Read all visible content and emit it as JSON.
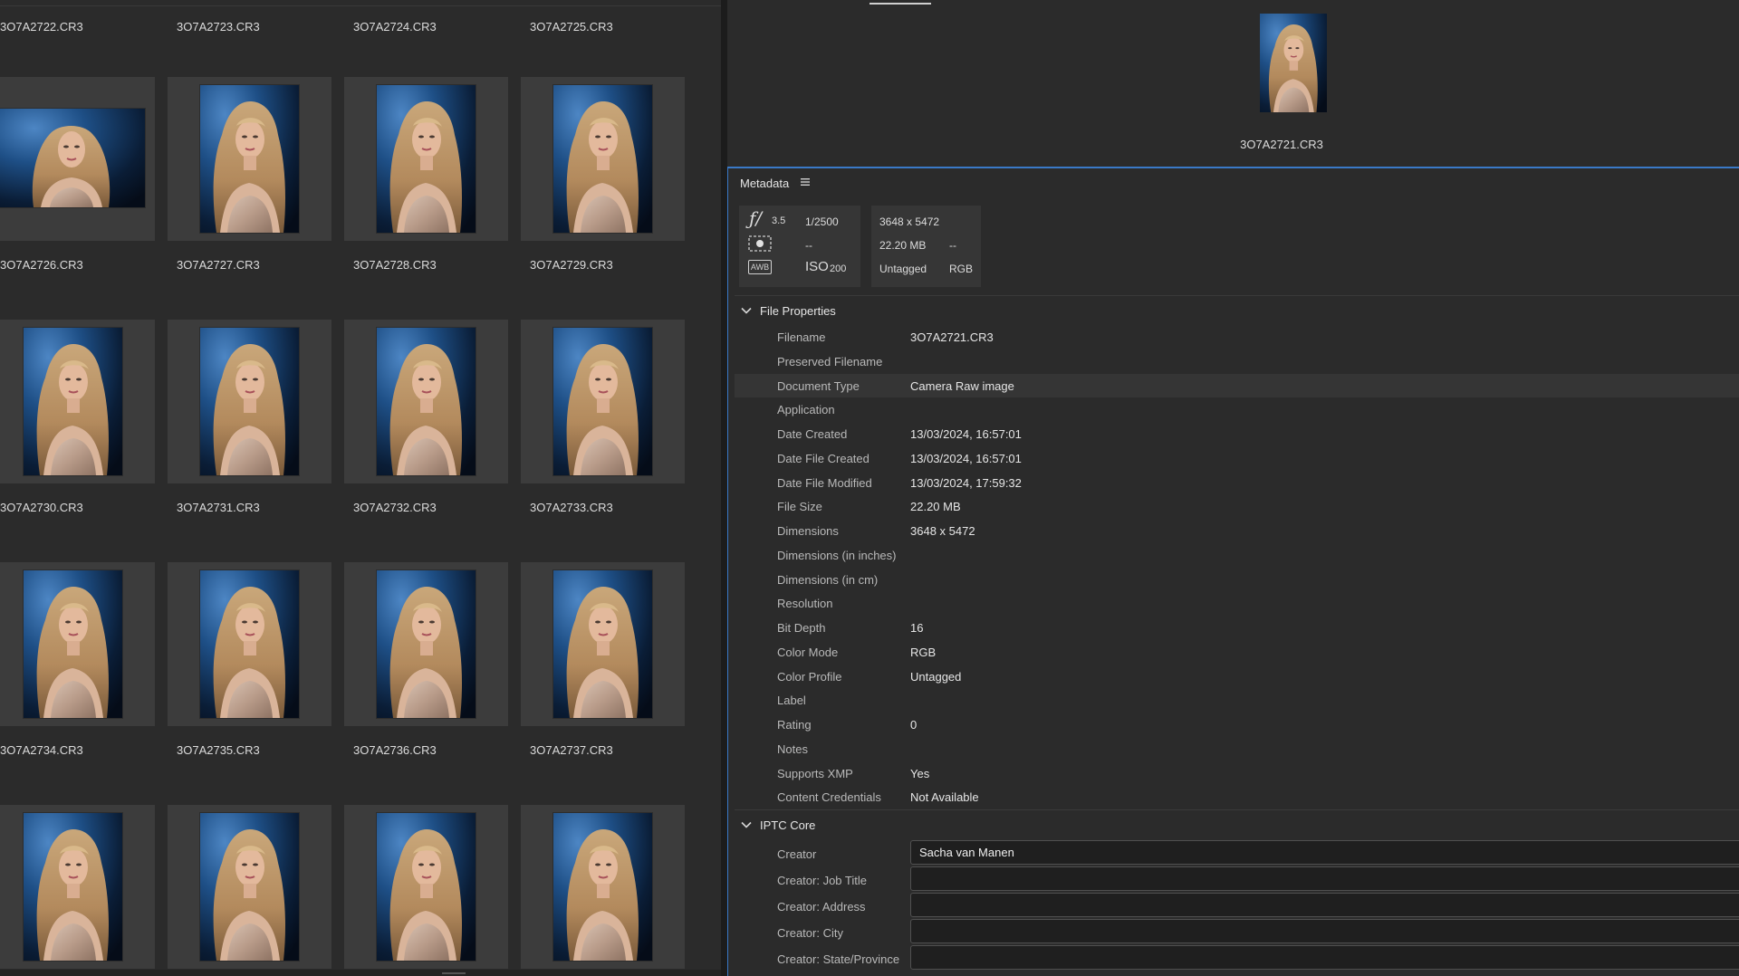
{
  "content": {
    "top_row_labels": [
      "3O7A2722.CR3",
      "3O7A2723.CR3",
      "3O7A2724.CR3",
      "3O7A2725.CR3"
    ],
    "rows": [
      [
        "3O7A2726.CR3",
        "3O7A2727.CR3",
        "3O7A2728.CR3",
        "3O7A2729.CR3"
      ],
      [
        "3O7A2730.CR3",
        "3O7A2731.CR3",
        "3O7A2732.CR3",
        "3O7A2733.CR3"
      ],
      [
        "3O7A2734.CR3",
        "3O7A2735.CR3",
        "3O7A2736.CR3",
        "3O7A2737.CR3"
      ],
      [
        "",
        "",
        "",
        ""
      ]
    ],
    "first_thumb_orientation": "landscape"
  },
  "preview": {
    "filename": "3O7A2721.CR3"
  },
  "metadata": {
    "tab_label": "Metadata",
    "summary": {
      "aperture_symbol": "ƒ/",
      "aperture": "3.5",
      "shutter": "1/2500",
      "metering": "--",
      "white_balance_badge": "AWB",
      "iso_label": "ISO",
      "iso": "200",
      "dimensions": "3648 x 5472",
      "size": "22.20 MB",
      "extra": "--",
      "color_profile": "Untagged",
      "color_mode": "RGB"
    },
    "file_properties": {
      "title": "File Properties",
      "rows": [
        {
          "label": "Filename",
          "value": "3O7A2721.CR3"
        },
        {
          "label": "Preserved Filename",
          "value": ""
        },
        {
          "label": "Document Type",
          "value": "Camera Raw image"
        },
        {
          "label": "Application",
          "value": ""
        },
        {
          "label": "Date Created",
          "value": "13/03/2024, 16:57:01"
        },
        {
          "label": "Date File Created",
          "value": "13/03/2024, 16:57:01"
        },
        {
          "label": "Date File Modified",
          "value": "13/03/2024, 17:59:32"
        },
        {
          "label": "File Size",
          "value": "22.20 MB"
        },
        {
          "label": "Dimensions",
          "value": "3648 x 5472"
        },
        {
          "label": "Dimensions (in inches)",
          "value": ""
        },
        {
          "label": "Dimensions (in cm)",
          "value": ""
        },
        {
          "label": "Resolution",
          "value": ""
        },
        {
          "label": "Bit Depth",
          "value": "16"
        },
        {
          "label": "Color Mode",
          "value": "RGB"
        },
        {
          "label": "Color Profile",
          "value": "Untagged"
        },
        {
          "label": "Label",
          "value": ""
        },
        {
          "label": "Rating",
          "value": "0"
        },
        {
          "label": "Notes",
          "value": ""
        },
        {
          "label": "Supports XMP",
          "value": "Yes"
        },
        {
          "label": "Content Credentials",
          "value": "Not Available"
        }
      ]
    },
    "iptc_core": {
      "title": "IPTC Core",
      "rows": [
        {
          "label": "Creator",
          "value": "Sacha van Manen"
        },
        {
          "label": "Creator: Job Title",
          "value": ""
        },
        {
          "label": "Creator: Address",
          "value": ""
        },
        {
          "label": "Creator: City",
          "value": ""
        },
        {
          "label": "Creator: State/Province",
          "value": ""
        }
      ]
    }
  },
  "colors": {
    "panel_bg": "#2b2b2b",
    "card_bg": "#3c3c3c",
    "accent": "#3a79c7",
    "text": "#dcdcdc"
  }
}
